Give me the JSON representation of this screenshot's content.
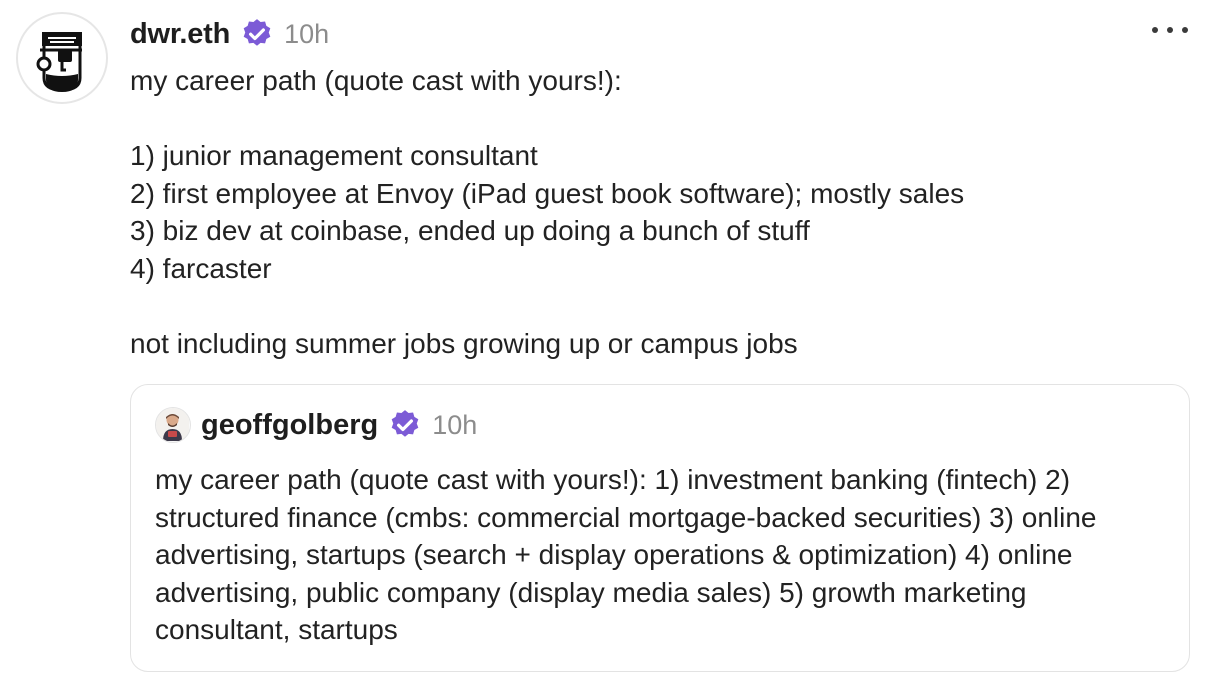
{
  "post": {
    "author": "dwr.eth",
    "time": "10h",
    "lines": [
      "my career path (quote cast with yours!):",
      "",
      "1) junior management consultant",
      "2) first employee at Envoy (iPad guest book software); mostly sales",
      "3) biz dev at coinbase, ended up doing a bunch of stuff",
      "4) farcaster",
      "",
      "not including summer jobs growing up or campus jobs"
    ]
  },
  "quote": {
    "author": "geoffgolberg",
    "time": "10h",
    "text": "my career path (quote cast with yours!): 1) investment banking (fintech) 2) structured finance (cmbs: commercial mortgage-backed securities) 3) online advertising, startups (search + display operations & optimization) 4) online advertising, public company (display media sales) 5) growth marketing consultant, startups"
  },
  "icons": {
    "verified": "verified-badge-icon",
    "more": "more-options-icon"
  },
  "colors": {
    "verified": "#7c5bd6",
    "muted": "#8c8c8c",
    "text": "#222222",
    "border": "#e3e3e3"
  }
}
